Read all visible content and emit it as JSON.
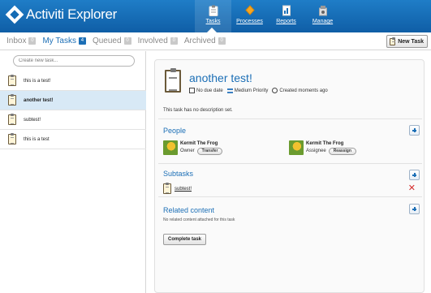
{
  "app": {
    "title": "Activiti Explorer"
  },
  "nav": [
    {
      "label": "Tasks",
      "icon": "clipboard-icon"
    },
    {
      "label": "Processes",
      "icon": "process-diamond-icon"
    },
    {
      "label": "Reports",
      "icon": "report-icon"
    },
    {
      "label": "Manage",
      "icon": "manage-icon"
    }
  ],
  "tabs": [
    {
      "label": "Inbox",
      "count": "0"
    },
    {
      "label": "My Tasks",
      "count": "4"
    },
    {
      "label": "Queued",
      "count": "0"
    },
    {
      "label": "Involved",
      "count": "0"
    },
    {
      "label": "Archived",
      "count": "0"
    }
  ],
  "toolbar": {
    "new_task": "New Task"
  },
  "create_task": {
    "placeholder": "Create new task..."
  },
  "task_list": [
    {
      "name": "this is a test!"
    },
    {
      "name": "another test!"
    },
    {
      "name": "subtest!"
    },
    {
      "name": "this is a test"
    }
  ],
  "detail": {
    "title": "another test!",
    "due": "No due date",
    "priority": "Medium Priority",
    "created": "Created moments ago",
    "description": "This task has no description set.",
    "people_heading": "People",
    "people": [
      {
        "name": "Kermit The Frog",
        "role": "Owner",
        "action": "Transfer"
      },
      {
        "name": "Kermit The Frog",
        "role": "Assignee",
        "action": "Reassign"
      }
    ],
    "subtasks_heading": "Subtasks",
    "subtasks": [
      {
        "name": "subtest!"
      }
    ],
    "related_heading": "Related content",
    "related_note": "No related content attached for this task",
    "complete_label": "Complete task"
  },
  "colors": {
    "header": "#1468b0",
    "accent": "#1c6fb6",
    "selected_row": "#d8e9f6",
    "delete": "#d42b2b"
  }
}
